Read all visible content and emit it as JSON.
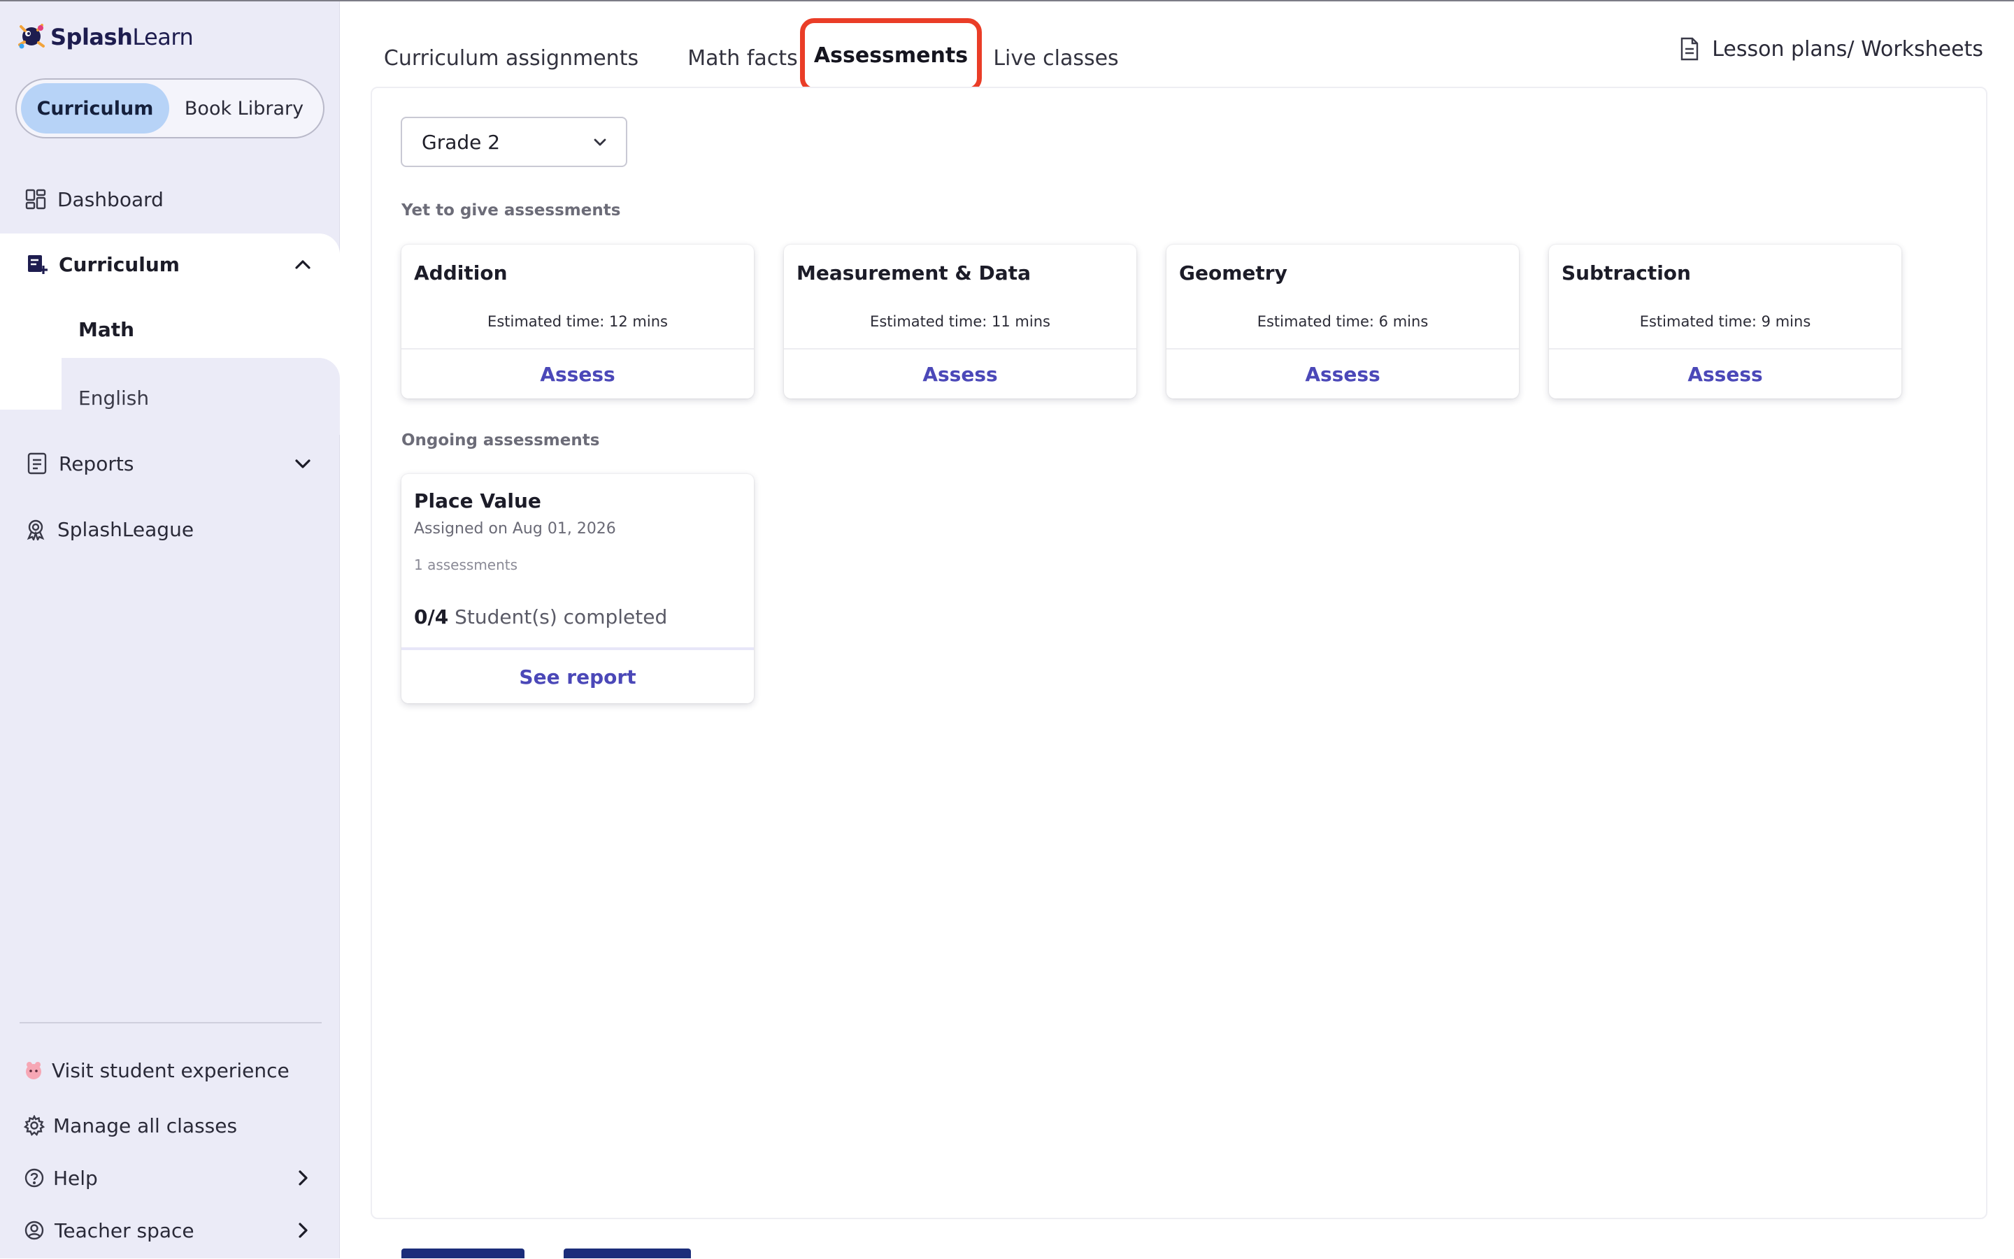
{
  "brand": {
    "name_bold": "Splash",
    "name_light": "Learn",
    "accent": "#4b48b8",
    "highlight": "#ea3d27"
  },
  "sidebar": {
    "segment": {
      "active": "Curriculum",
      "inactive": "Book Library"
    },
    "nav": {
      "dashboard": "Dashboard",
      "curriculum": "Curriculum",
      "math": "Math",
      "english": "English",
      "reports": "Reports",
      "splashleague": "SplashLeague"
    },
    "bottom": {
      "visit": "Visit student experience",
      "manage": "Manage all classes",
      "help": "Help",
      "teacher": "Teacher space"
    }
  },
  "tabs": {
    "curriculum_assignments": "Curriculum assignments",
    "math_facts": "Math facts",
    "assessments": "Assessments",
    "live_classes": "Live classes",
    "lesson_plans": "Lesson plans/ Worksheets"
  },
  "grade": {
    "selected": "Grade 2"
  },
  "sections": {
    "yet_to_give": "Yet to give assessments",
    "ongoing": "Ongoing assessments"
  },
  "yet_cards": [
    {
      "title": "Addition",
      "estimate": "Estimated time: 12 mins",
      "action": "Assess"
    },
    {
      "title": "Measurement & Data",
      "estimate": "Estimated time: 11 mins",
      "action": "Assess"
    },
    {
      "title": "Geometry",
      "estimate": "Estimated time: 6 mins",
      "action": "Assess"
    },
    {
      "title": "Subtraction",
      "estimate": "Estimated time: 9 mins",
      "action": "Assess"
    }
  ],
  "ongoing_card": {
    "title": "Place Value",
    "assigned": "Assigned on Aug 01, 2026",
    "count": "1 assessments",
    "completed": "0/4",
    "completed_label": " Student(s) completed",
    "action": "See report"
  }
}
